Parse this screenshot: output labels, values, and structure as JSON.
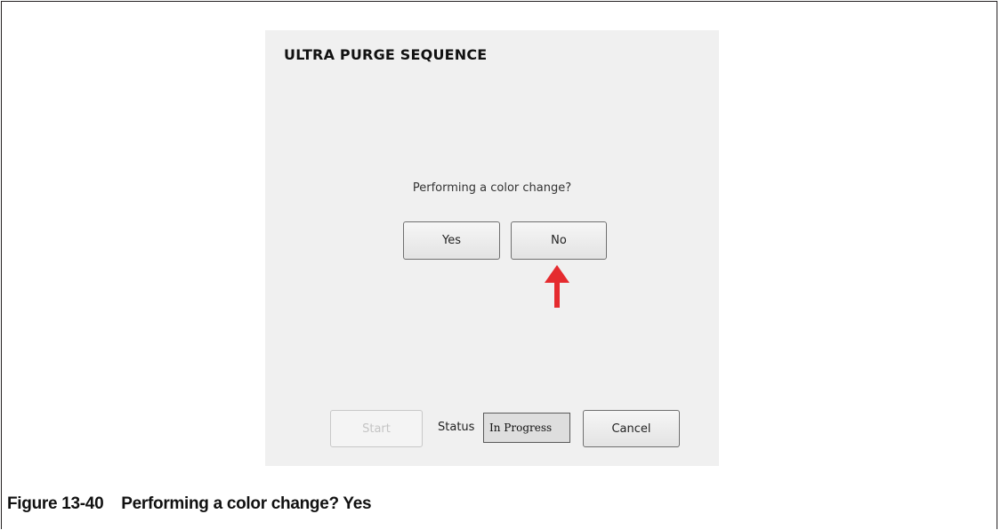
{
  "dialog": {
    "title": "ULTRA PURGE SEQUENCE",
    "question": "Performing a color change?",
    "yes_label": "Yes",
    "no_label": "No",
    "start_label": "Start",
    "status_label": "Status",
    "status_value": "In Progress",
    "cancel_label": "Cancel"
  },
  "arrow_color": "#e52b2f",
  "caption": {
    "number": "Figure 13-40",
    "text": "Performing a color change? Yes"
  }
}
